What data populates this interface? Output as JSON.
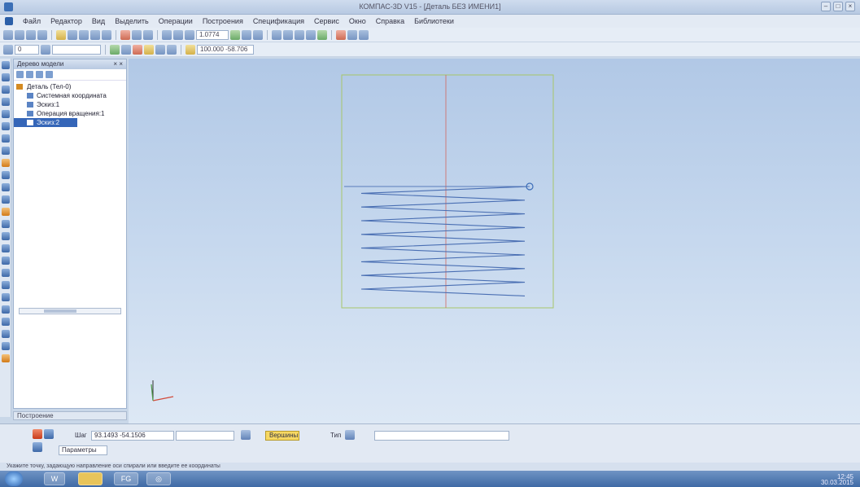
{
  "window": {
    "title": "КОМПАС-3D V15 - [Деталь БЕЗ ИМЕНИ1]"
  },
  "menu": [
    "Файл",
    "Редактор",
    "Вид",
    "Выделить",
    "Операции",
    "Построения",
    "Спецификация",
    "Сервис",
    "Окно",
    "Справка",
    "Библиотеки"
  ],
  "toolbar": {
    "zoom_value": "1.0774",
    "layer_value": "0",
    "coord_value": "100.000 -58.706"
  },
  "tree": {
    "header": "Дерево модели",
    "nodes": [
      "Деталь (Тел-0)",
      "Системная координата",
      "Эскиз:1",
      "Операция вращения:1",
      "Эскиз:2"
    ],
    "tab": "Построение"
  },
  "propbar": {
    "param_label": "Шаг",
    "param_value": "93.1493 -54.1506",
    "mode_value": "Вершины",
    "snap_label": "Тип",
    "tab_label": "Параметры"
  },
  "status": {
    "text": "Укажите точку, задающую направление оси спирали или введите ее координаты"
  },
  "taskbar": {
    "items": [
      "W",
      "",
      "FG",
      "◎"
    ],
    "time": "12:45",
    "date": "30.03.2015"
  }
}
